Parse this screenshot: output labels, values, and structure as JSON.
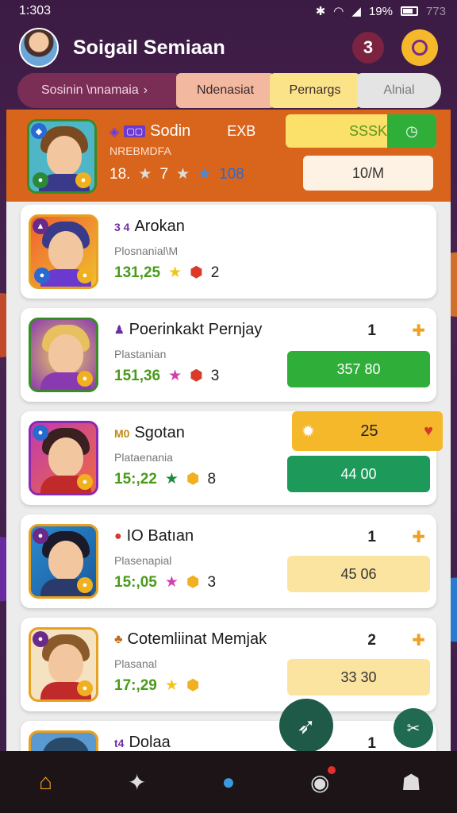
{
  "status": {
    "time": "1:303",
    "battery": "19%",
    "extra": "773"
  },
  "header": {
    "title": "Soigail Semiaan",
    "badge_count": "3"
  },
  "tabs": [
    {
      "label": "Sosinin \\nnamaia"
    },
    {
      "label": "Ndenasiat"
    },
    {
      "label": "Pernargs"
    },
    {
      "label": "Alnial"
    }
  ],
  "featured": {
    "name": "Sodin",
    "tag": "EXB",
    "sub": "NREBMDFA",
    "stats": "18.",
    "extra": "7",
    "gems": "108",
    "pill_top": "SSSKI",
    "pill_bottom": "10/M"
  },
  "cards": [
    {
      "icon": "3 4",
      "name": "Arokan",
      "sub": "Plosnanial\\M",
      "score": "131,25",
      "gems": "2"
    },
    {
      "name": "Poerinkakt Pernjay",
      "sub": "Plastanian",
      "score": "151,36",
      "gems": "3",
      "rank": "1",
      "pill": "357 80"
    },
    {
      "icon": "M0",
      "name": "Sgotan",
      "sub": "Plataenania",
      "score": "15:,22",
      "gems": "8",
      "rank": "25",
      "pill": "44 00"
    },
    {
      "icon": "IO",
      "name": "Batıan",
      "sub": "Plasenapial",
      "score": "15:,05",
      "gems": "3",
      "rank": "1",
      "pill": "45 06"
    },
    {
      "name": "Cotemliinat Memjak",
      "sub": "Plasanal",
      "score": "17:,29",
      "rank": "2",
      "pill": "33 30"
    },
    {
      "icon": "t4",
      "name": "Dolaa",
      "rank": "1"
    }
  ],
  "colors": {
    "accent": "#d9651c",
    "bg": "#3a1d3f",
    "green": "#2fae3a"
  }
}
